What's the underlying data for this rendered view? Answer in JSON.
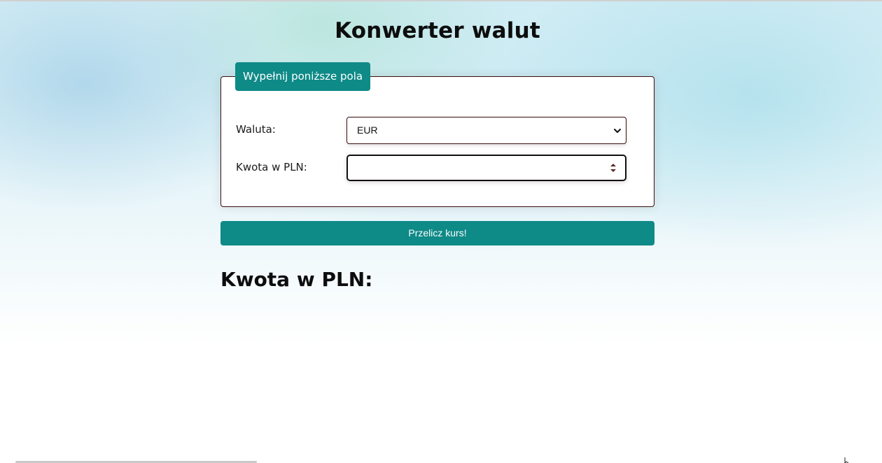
{
  "page": {
    "title": "Konwerter walut"
  },
  "form": {
    "legend": "Wypełnij poniższe pola",
    "currency_label": "Waluta:",
    "currency_selected": "EUR",
    "amount_label": "Kwota w PLN:",
    "amount_value": "",
    "amount_placeholder": ""
  },
  "actions": {
    "submit_label": "Przelicz kurs!"
  },
  "result": {
    "heading": "Kwota w PLN:"
  },
  "icons": {
    "select": "chevron-down-icon",
    "number": "spinner-icon"
  },
  "colors": {
    "accent": "#0e8a87",
    "border": "#3a1010",
    "text": "#0d0d0d"
  }
}
